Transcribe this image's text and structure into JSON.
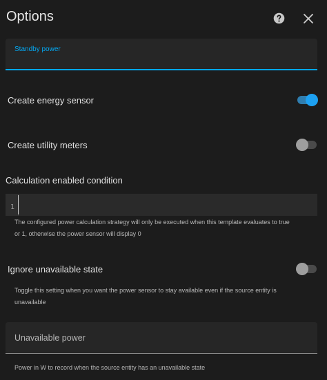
{
  "dialog": {
    "title": "Options",
    "help_icon": "help-circle-icon",
    "close_icon": "close-icon"
  },
  "standby_power": {
    "label": "Standby power",
    "value": ""
  },
  "create_energy_sensor": {
    "label": "Create energy sensor",
    "checked": true
  },
  "create_utility_meters": {
    "label": "Create utility meters",
    "checked": false
  },
  "calculation_enabled_condition": {
    "label": "Calculation enabled condition",
    "line_number": "1",
    "code": "",
    "helper_line1": "The configured power calculation strategy will only be executed when this template evaluates to true",
    "helper_line2": "or 1, otherwise the power sensor will display 0"
  },
  "ignore_unavailable_state": {
    "label": "Ignore unavailable state",
    "checked": false,
    "helper_line1": "Toggle this setting when you want the power sensor to stay available even if the source entity is",
    "helper_line2": "unavailable"
  },
  "unavailable_power": {
    "placeholder": "Unavailable power",
    "helper": "Power in W to record when the source entity has an unavailable state"
  },
  "colors": {
    "accent": "#03a9f4",
    "background": "#1c1c1c",
    "field": "#262626"
  }
}
